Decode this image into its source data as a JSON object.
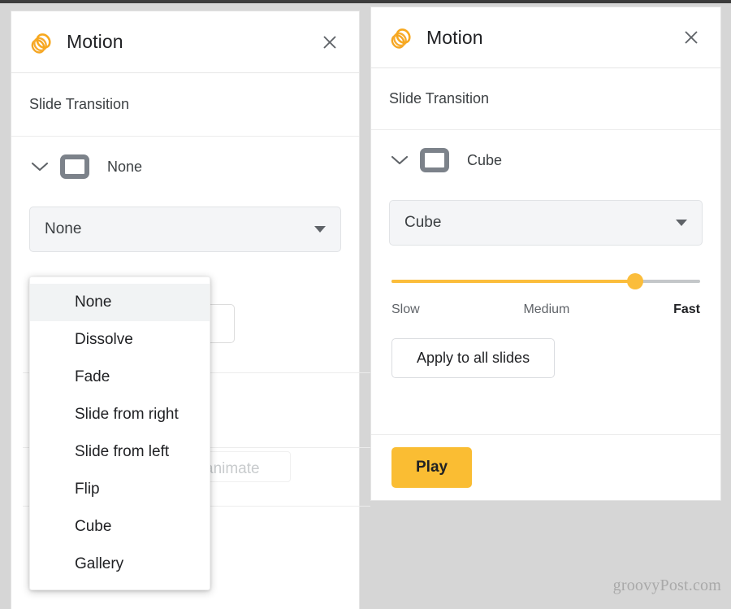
{
  "watermark": "groovyPost.com",
  "panels": {
    "left": {
      "header": {
        "title": "Motion",
        "app_icon": "motion-layers-icon",
        "close_icon": "close-icon"
      },
      "section_heading": "Slide Transition",
      "transition_row": {
        "chevron_icon": "chevron-down-icon",
        "preview_icon": "slide-preview-icon",
        "label": "None"
      },
      "select": {
        "value": "None",
        "caret_icon": "caret-down-icon"
      },
      "dropdown": {
        "open": true,
        "selected": "None",
        "options": [
          "None",
          "Dissolve",
          "Fade",
          "Slide from right",
          "Slide from left",
          "Flip",
          "Cube",
          "Gallery"
        ]
      },
      "obscured": {
        "animate_text": "animate"
      }
    },
    "right": {
      "header": {
        "title": "Motion",
        "app_icon": "motion-layers-icon",
        "close_icon": "close-icon"
      },
      "section_heading": "Slide Transition",
      "transition_row": {
        "chevron_icon": "chevron-down-icon",
        "preview_icon": "slide-preview-icon",
        "label": "Cube"
      },
      "select": {
        "value": "Cube",
        "caret_icon": "caret-down-icon"
      },
      "speed_slider": {
        "value_percent": 79,
        "labels": {
          "slow": "Slow",
          "medium": "Medium",
          "fast": "Fast"
        },
        "active_label": "Fast"
      },
      "apply_button": "Apply to all slides",
      "play_button": "Play"
    }
  },
  "colors": {
    "accent": "#fabd33",
    "slider_fill": "#fbbd3b",
    "track": "#c4c7c9",
    "panel_bg": "#ffffff",
    "page_bg": "#d6d6d6",
    "text": "#202124",
    "muted_text": "#5f6368",
    "thumb_gray": "#7c828a"
  }
}
